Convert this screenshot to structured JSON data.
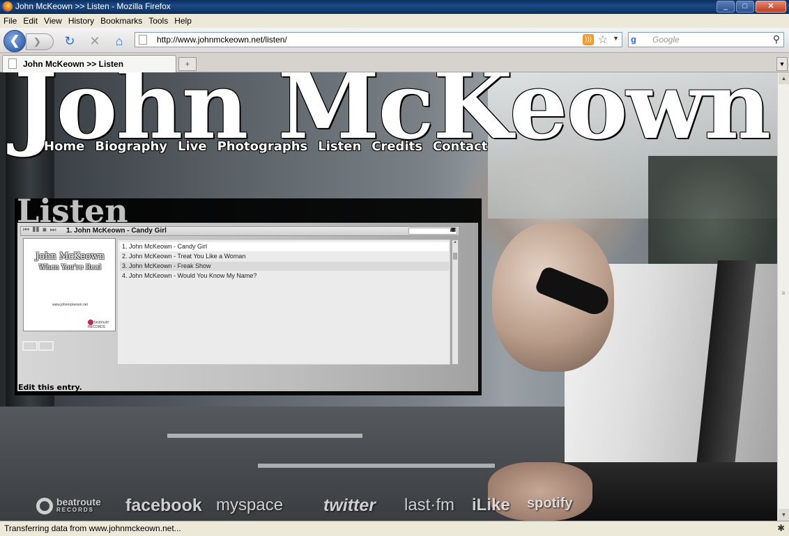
{
  "window": {
    "title": "John McKeown >> Listen - Mozilla Firefox",
    "min": "_",
    "max": "□",
    "close": "✕"
  },
  "menu": [
    "File",
    "Edit",
    "View",
    "History",
    "Bookmarks",
    "Tools",
    "Help"
  ],
  "nav": {
    "back": "❮",
    "forward": "❯",
    "reload": "↻",
    "stop": "✕",
    "home": "⌂",
    "url": "http://www.johnmckeown.net/listen/",
    "rss": ")))",
    "star": "☆",
    "drop": "▼"
  },
  "search": {
    "placeholder": "Google",
    "engine": "g",
    "icon": "⚲"
  },
  "tabs": {
    "active": "John McKeown >> Listen",
    "new": "+",
    "list": "▼"
  },
  "site": {
    "title": "John McKeown",
    "nav": [
      "Home",
      "Biography",
      "Live",
      "Photographs",
      "Listen",
      "Credits",
      "Contact"
    ],
    "section": "Listen",
    "edit_link": "Edit this entry."
  },
  "player": {
    "controls": "⏮ ❚❚ ■ ⏭",
    "now_playing": "1. John McKeown - Candy Girl",
    "volume": "ıllllllll",
    "album": {
      "artist": "John McKeown",
      "title": "When You're Real",
      "url": "www.johnmckeown.net",
      "label": "beatroute RECORDS"
    },
    "tracks": [
      "1. John McKeown - Candy Girl",
      "2. John McKeown - Treat You Like a Woman",
      "3. John McKeown - Freak Show",
      "4. John McKeown - Would You Know My Name?"
    ]
  },
  "social": {
    "beatroute": "beatroute",
    "beatroute_sub": "RECORDS",
    "facebook": "facebook",
    "myspace": "myspace",
    "twitter": "twitter",
    "lastfm": "last·fm",
    "ilike": "iLike",
    "spotify": "spotify"
  },
  "scrollbar": {
    "up": "▲",
    "down": "▼",
    "grip": "≡"
  },
  "status": {
    "text": "Transferring data from www.johnmckeown.net...",
    "bug": "✱"
  },
  "colors": {
    "titlebar": "#1c4a86",
    "content_overlay": "#000000",
    "link": "#ffffff"
  }
}
